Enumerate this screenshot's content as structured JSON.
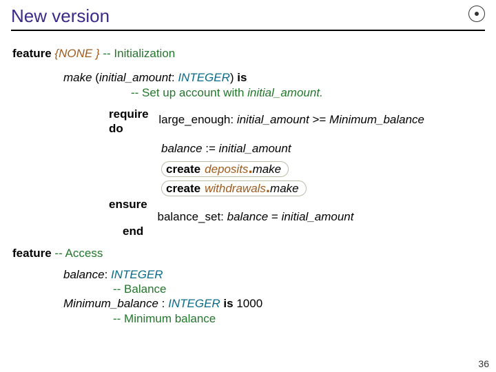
{
  "title": "New version",
  "slide_number": "36",
  "code": {
    "feature_none_kw": "feature",
    "feature_none_export": "{NONE }",
    "feature_none_comment": "-- Initialization",
    "make_name": "make",
    "make_arg": "initial_amount",
    "make_arg_type": "INTEGER",
    "is_kw": "is",
    "make_doc": "-- Set up account with",
    "make_doc_arg": "initial_amount",
    "require_kw": "require",
    "do_kw": "do",
    "require_label": "large_enough:",
    "require_expr_left": "initial_amount",
    "require_expr_op": " >= ",
    "require_expr_right": "Minimum_balance",
    "body_assign_left": "balance",
    "body_assign_op": " := ",
    "body_assign_right": "initial_amount",
    "create_kw": "create",
    "create1_target": "deposits",
    "create1_call": "make",
    "create2_target": "withdrawals",
    "create2_call": "make",
    "ensure_kw": "ensure",
    "ensure_label": "balance_set:",
    "ensure_expr_left": "balance",
    "ensure_expr_op": " = ",
    "ensure_expr_right": "initial_amount",
    "end_kw": "end",
    "feature_access_kw": "feature",
    "feature_access_comment": "-- Access",
    "balance_name": "balance",
    "balance_type": "INTEGER",
    "balance_doc": "-- Balance",
    "min_name": "Minimum_balance",
    "min_type": "INTEGER",
    "min_is_kw": "is",
    "min_value": "1000",
    "min_doc": "-- Minimum balance"
  }
}
